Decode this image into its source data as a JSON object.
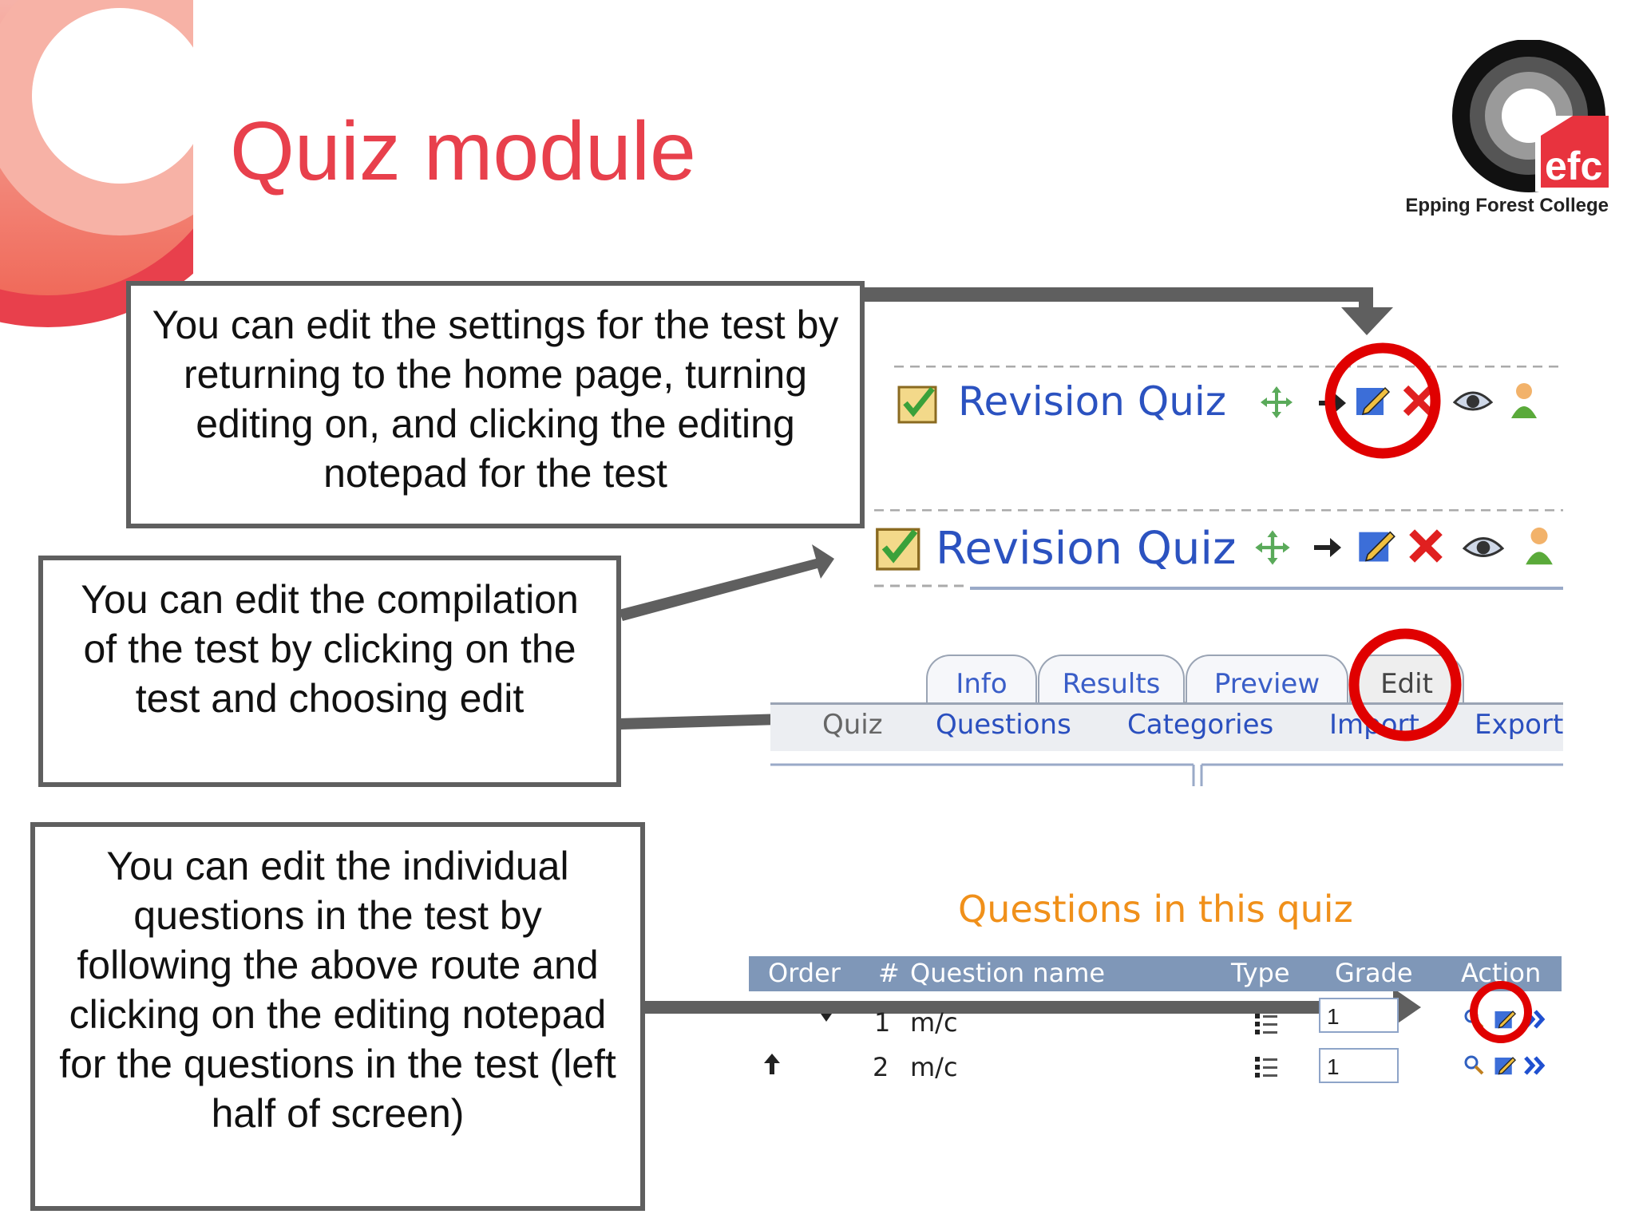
{
  "slide": {
    "title": "Quiz module",
    "brand_color": "#e8404c"
  },
  "logo": {
    "mark_text": "efc",
    "caption": "Epping Forest College"
  },
  "callouts": [
    {
      "text": "You can edit the settings for the test by returning to the home page, turning editing on, and clicking the editing notepad for the test"
    },
    {
      "text": "You can edit the compilation of the test by clicking on the test and choosing edit"
    },
    {
      "text": "You can edit the individual questions in the test by following the above route and clicking on the editing notepad for the questions in the test (left half of screen)"
    }
  ],
  "quiz_rows": [
    {
      "name": "Revision Quiz"
    },
    {
      "name": "Revision Quiz"
    }
  ],
  "tabs": [
    "Info",
    "Results",
    "Preview",
    "Edit"
  ],
  "subtabs": [
    "Quiz",
    "Questions",
    "Categories",
    "Import",
    "Export"
  ],
  "questions": {
    "heading": "Questions in this quiz",
    "columns": [
      "Order",
      "#",
      "Question name",
      "Type",
      "Grade",
      "Action"
    ],
    "rows": [
      {
        "number": "1",
        "name": "m/c",
        "grade": "1"
      },
      {
        "number": "2",
        "name": "m/c",
        "grade": "1"
      }
    ]
  },
  "icons": [
    "move-icon",
    "arrow-right-icon",
    "edit-notepad-icon",
    "delete-icon",
    "eye-icon",
    "user-icon",
    "preview-magnifier-icon",
    "chevrons-right-icon",
    "arrow-up-icon",
    "arrow-down-icon",
    "list-icon"
  ],
  "highlight_color": "#e00000",
  "arrow_color": "#5f5f5f"
}
